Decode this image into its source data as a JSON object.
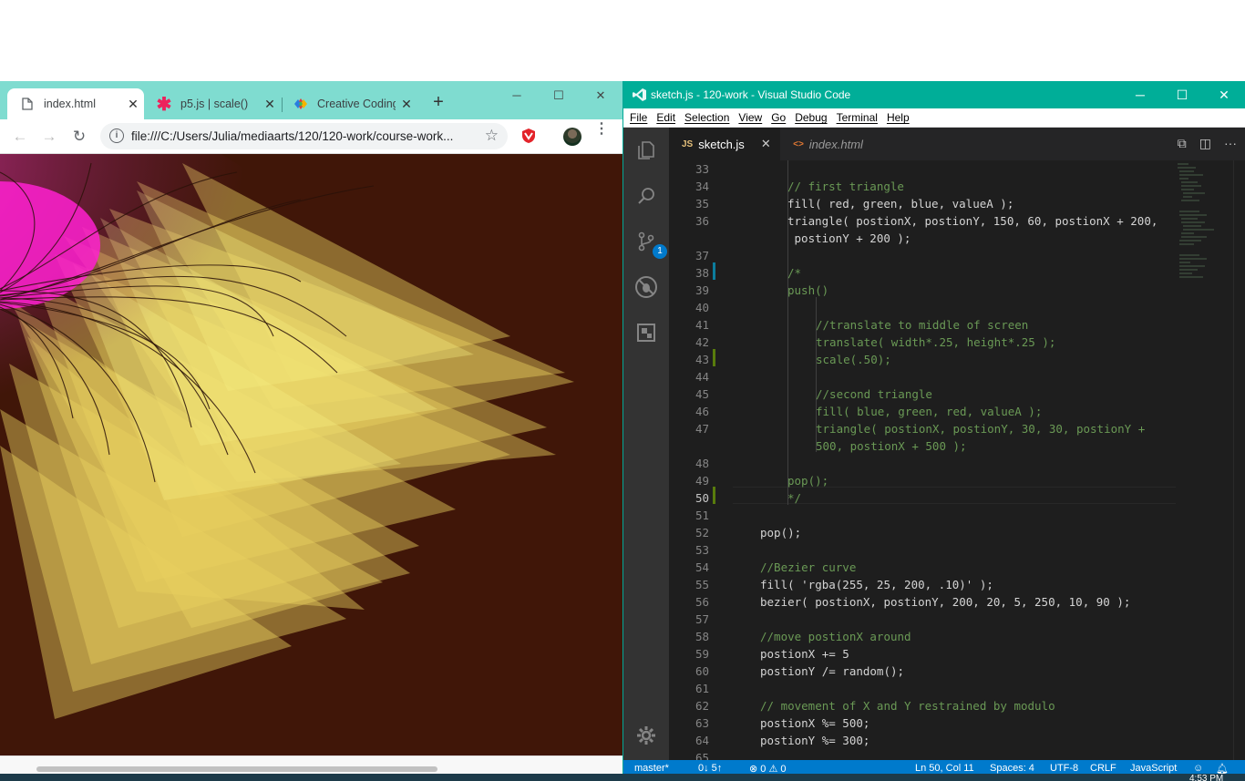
{
  "chrome": {
    "tabs": [
      {
        "title": "index.html",
        "icon": "file-icon",
        "active": true
      },
      {
        "title": "p5.js | scale()",
        "icon": "p5-asterisk-icon",
        "active": false
      },
      {
        "title": "Creative Coding",
        "icon": "colorful-diamond-icon",
        "active": false
      }
    ],
    "new_tab": "+",
    "controls": {
      "minimize": "─",
      "maximize": "☐",
      "close": "✕"
    },
    "nav": {
      "back": "←",
      "forward": "→",
      "reload": "↻"
    },
    "url": "file:///C:/Users/Julia/mediaarts/120/120-work/course-work...",
    "info_glyph": "i",
    "star": "☆",
    "menu": "⋮",
    "canvas_background": "#401608"
  },
  "vscode": {
    "title": "sketch.js - 120-work - Visual Studio Code",
    "window_controls": {
      "minimize": "─",
      "maximize": "☐",
      "close": "✕"
    },
    "menu": [
      "File",
      "Edit",
      "Selection",
      "View",
      "Go",
      "Debug",
      "Terminal",
      "Help"
    ],
    "scm_badge": "1",
    "tabs": [
      {
        "label": "sketch.js",
        "icon": "JS",
        "close": "✕",
        "active": true
      },
      {
        "label": "index.html",
        "icon": "<>",
        "active": false
      }
    ],
    "lines": [
      {
        "n": "33",
        "text": ""
      },
      {
        "n": "34",
        "text": "// first triangle"
      },
      {
        "n": "35",
        "text": "fill( red, green, blue, valueA );"
      },
      {
        "n": "36",
        "text": "triangle( postionX, postionY, 150, 60, postionX + 200,"
      },
      {
        "n": "",
        "text": " postionY + 200 );"
      },
      {
        "n": "37",
        "text": ""
      },
      {
        "n": "38",
        "text": "/*"
      },
      {
        "n": "39",
        "text": "push()"
      },
      {
        "n": "40",
        "text": ""
      },
      {
        "n": "41",
        "text": "//translate to middle of screen"
      },
      {
        "n": "42",
        "text": "translate( width*.25, height*.25 );"
      },
      {
        "n": "43",
        "text": "scale(.50);"
      },
      {
        "n": "44",
        "text": ""
      },
      {
        "n": "45",
        "text": "//second triangle"
      },
      {
        "n": "46",
        "text": "fill( blue, green, red, valueA );"
      },
      {
        "n": "47",
        "text": "triangle( postionX, postionY, 30, 30, postionY +"
      },
      {
        "n": "",
        "text": "500, postionX + 500 );"
      },
      {
        "n": "48",
        "text": ""
      },
      {
        "n": "49",
        "text": "pop();"
      },
      {
        "n": "50",
        "text": "*/"
      },
      {
        "n": "51",
        "text": ""
      },
      {
        "n": "52",
        "text": "pop();"
      },
      {
        "n": "53",
        "text": ""
      },
      {
        "n": "54",
        "text": "//Bezier curve"
      },
      {
        "n": "55",
        "text": "fill( 'rgba(255, 25, 200, .10)' );"
      },
      {
        "n": "56",
        "text": "bezier( postionX, postionY, 200, 20, 5, 250, 10, 90 );"
      },
      {
        "n": "57",
        "text": ""
      },
      {
        "n": "58",
        "text": "//move postionX around"
      },
      {
        "n": "59",
        "text": "postionX += 5"
      },
      {
        "n": "60",
        "text": "postionY /= random();"
      },
      {
        "n": "61",
        "text": ""
      },
      {
        "n": "62",
        "text": "// movement of X and Y restrained by modulo"
      },
      {
        "n": "63",
        "text": "postionX %= 500;"
      },
      {
        "n": "64",
        "text": "postionY %= 300;"
      },
      {
        "n": "65",
        "text": ""
      }
    ],
    "status": {
      "branch": "master*",
      "sync": "0↓ 5↑",
      "problems": "⊗ 0 ⚠ 0",
      "position": "Ln 50, Col 11",
      "spaces": "Spaces: 4",
      "encoding": "UTF-8",
      "eol": "CRLF",
      "language": "JavaScript"
    }
  },
  "taskbar": {
    "clock": "4:53 PM"
  }
}
